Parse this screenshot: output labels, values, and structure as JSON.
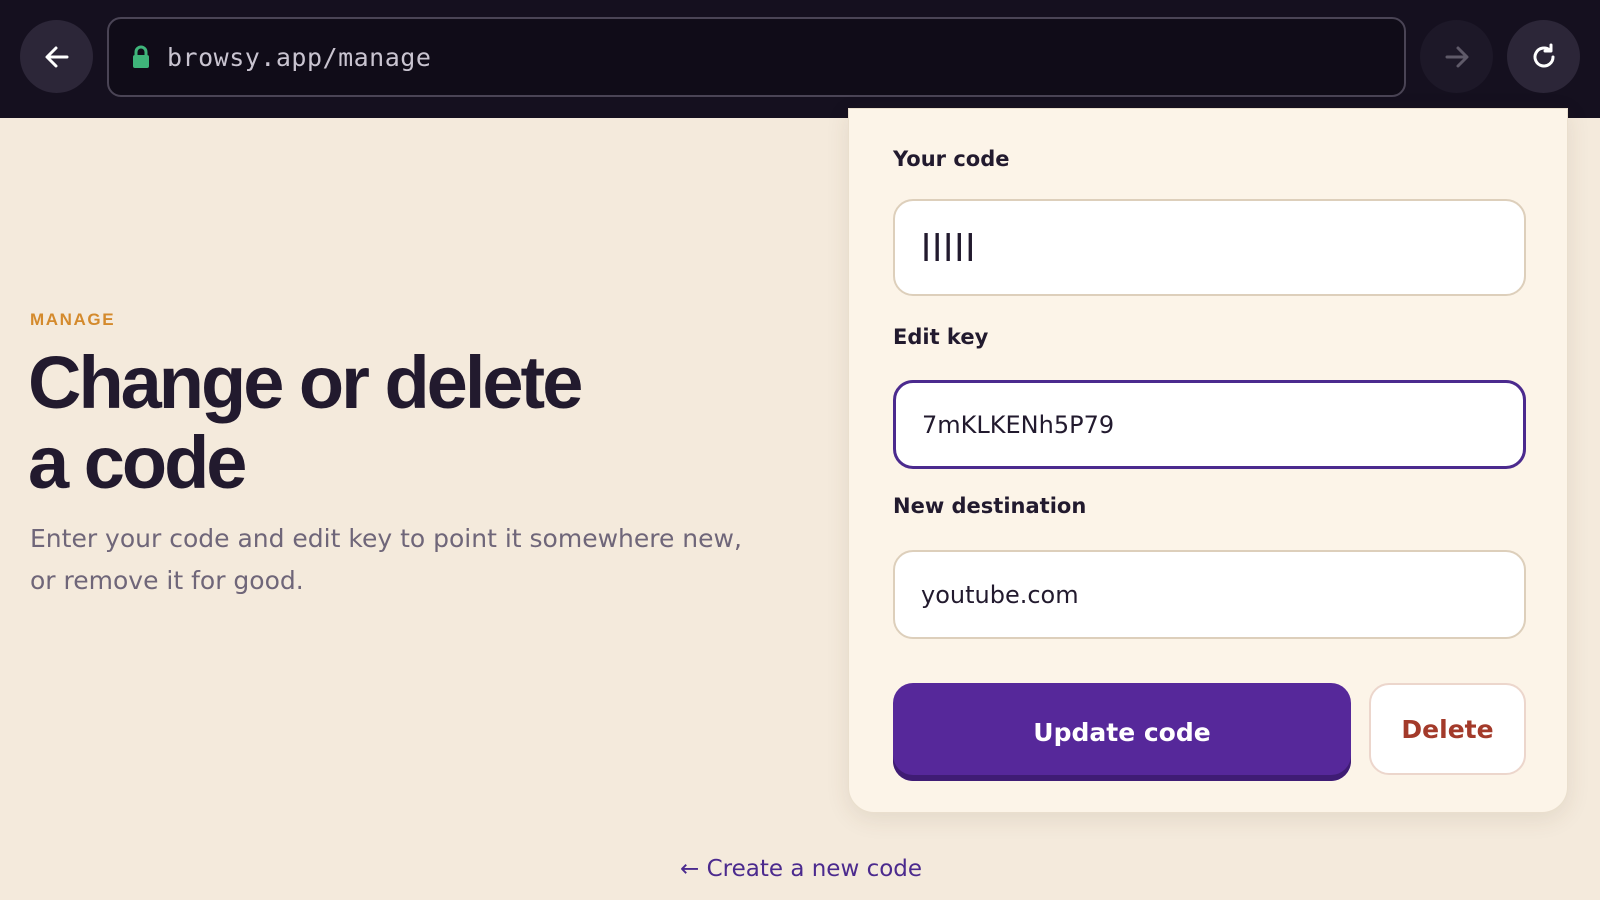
{
  "browser": {
    "url": "browsy.app/manage",
    "back_icon": "arrow-left-icon",
    "forward_icon": "arrow-right-icon",
    "reload_icon": "reload-icon",
    "lock_icon": "lock-icon"
  },
  "hero": {
    "eyebrow": "MANAGE",
    "headline_line1": "Change or delete",
    "headline_line2": "a code",
    "lede": "Enter your code and edit key to point it somewhere new, or remove it for good."
  },
  "form": {
    "code_label": "Your code",
    "code_value": "IIIII",
    "key_label": "Edit key",
    "key_value": "7mKLKENh5P79",
    "dest_label": "New destination",
    "dest_value": "youtube.com",
    "update_label": "Update code",
    "delete_label": "Delete"
  },
  "footer": {
    "create_link": "← Create a new code"
  },
  "colors": {
    "accent": "#56289a",
    "eyebrow": "#d48a2c",
    "danger": "#a33a2a",
    "background": "#f4eadc"
  }
}
